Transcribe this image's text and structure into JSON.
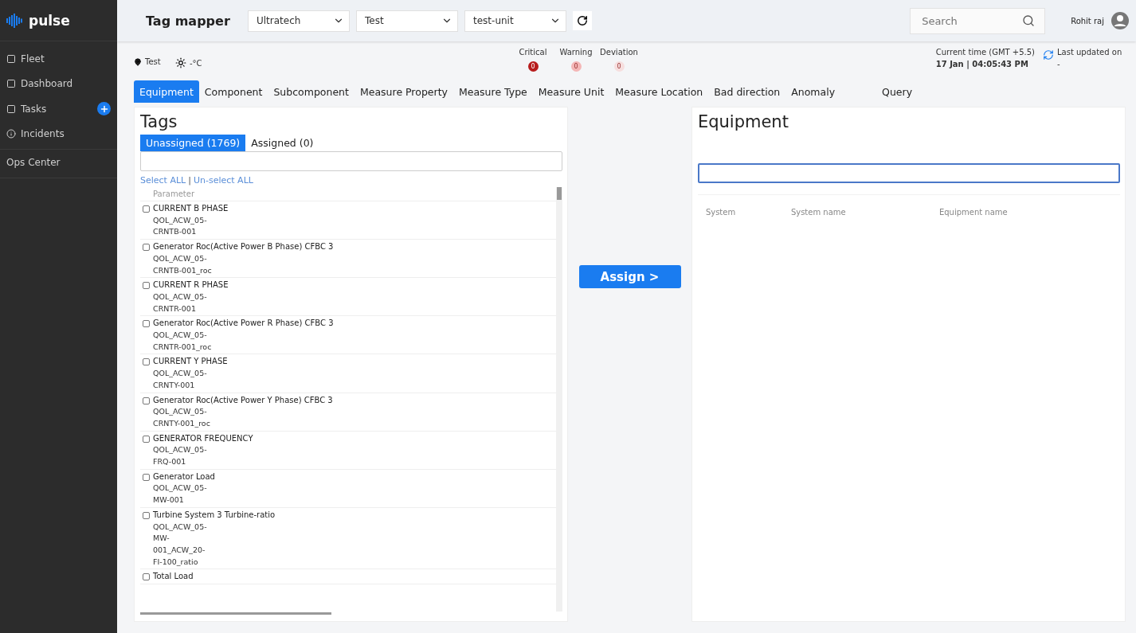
{
  "brand": "pulse",
  "sidebar": {
    "items": [
      {
        "label": "Fleet",
        "kind": "icon"
      },
      {
        "label": "Dashboard",
        "kind": "icon"
      },
      {
        "label": "Tasks",
        "kind": "add"
      },
      {
        "label": "Incidents",
        "kind": "info"
      },
      {
        "label": "Ops Center",
        "kind": "plain"
      }
    ]
  },
  "header": {
    "title": "Tag mapper",
    "dropdowns": [
      "Ultratech",
      "Test",
      "test-unit"
    ],
    "search": {
      "placeholder": "Search"
    },
    "user": "Rohit raj"
  },
  "info": {
    "location": "Test",
    "weather": "-°C",
    "severities": [
      {
        "label": "Critical",
        "count": "0",
        "color": "#b71c1c"
      },
      {
        "label": "Warning",
        "count": "0",
        "color": "#f4b6b6"
      },
      {
        "label": "Deviation",
        "count": "0",
        "color": "#f6dede"
      }
    ],
    "time_label": "Current time (GMT +5.5)",
    "time": "17 Jan | 04:05:43 PM",
    "updated_label": "Last updated on",
    "updated": "-"
  },
  "tabs": [
    {
      "label": "Equipment",
      "selected": true
    },
    {
      "label": "Component",
      "selected": false
    },
    {
      "label": "Subcomponent",
      "selected": false
    },
    {
      "label": "Measure Property",
      "selected": false
    },
    {
      "label": "Measure Type",
      "selected": false
    },
    {
      "label": "Measure Unit",
      "selected": false
    },
    {
      "label": "Measure Location",
      "selected": false
    },
    {
      "label": "Bad direction",
      "selected": false
    },
    {
      "label": "Anomaly",
      "selected": false
    },
    {
      "label": "Query",
      "selected": false
    }
  ],
  "tags": {
    "title": "Tags",
    "subtabs": [
      {
        "label": "Unassigned (1769)",
        "selected": true
      },
      {
        "label": "Assigned (0)",
        "selected": false
      }
    ],
    "select_all": "Select ALL",
    "separator": "|",
    "unselect_all": "Un-select ALL",
    "column": "Parameter",
    "rows": [
      {
        "name": "CURRENT B PHASE",
        "code": [
          "QOL_ACW_05-",
          "CRNTB-001"
        ],
        "checked": false
      },
      {
        "name": "Generator Roc(Active Power B Phase) CFBC 3",
        "code": [
          "QOL_ACW_05-",
          "CRNTB-001_roc"
        ],
        "checked": false
      },
      {
        "name": "CURRENT R PHASE",
        "code": [
          "QOL_ACW_05-",
          "CRNTR-001"
        ],
        "checked": false
      },
      {
        "name": "Generator Roc(Active Power R Phase) CFBC 3",
        "code": [
          "QOL_ACW_05-",
          "CRNTR-001_roc"
        ],
        "checked": false
      },
      {
        "name": "CURRENT Y PHASE",
        "code": [
          "QOL_ACW_05-",
          "CRNTY-001"
        ],
        "checked": false
      },
      {
        "name": "Generator Roc(Active Power Y Phase) CFBC 3",
        "code": [
          "QOL_ACW_05-",
          "CRNTY-001_roc"
        ],
        "checked": false
      },
      {
        "name": "GENERATOR FREQUENCY",
        "code": [
          "QOL_ACW_05-",
          "FRQ-001"
        ],
        "checked": false
      },
      {
        "name": "Generator Load",
        "code": [
          "QOL_ACW_05-",
          "MW-001"
        ],
        "checked": false
      },
      {
        "name": "Turbine System 3 Turbine-ratio",
        "code": [
          "QOL_ACW_05-",
          "MW-",
          "001_ACW_20-",
          "FI-100_ratio"
        ],
        "checked": false
      },
      {
        "name": "Total Load",
        "code": [],
        "checked": false
      }
    ]
  },
  "assign_button": "Assign >",
  "equipment": {
    "title": "Equipment",
    "columns": [
      "System",
      "System name",
      "Equipment name"
    ]
  }
}
